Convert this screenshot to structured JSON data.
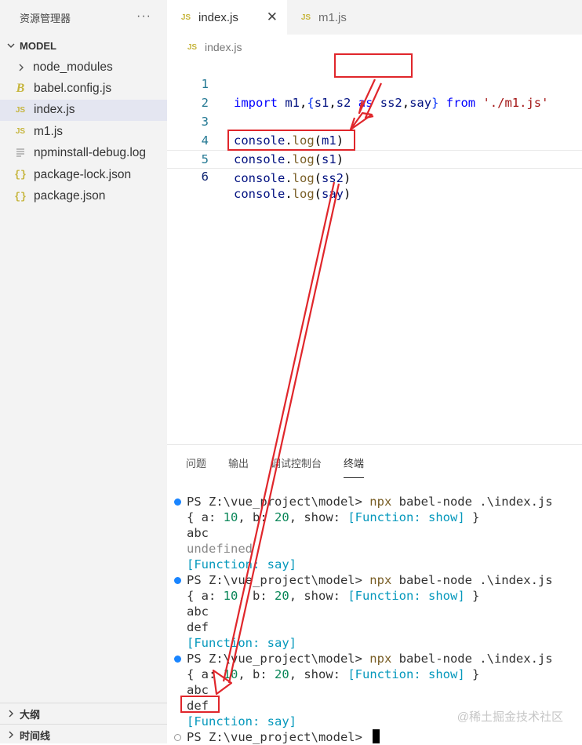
{
  "sidebar": {
    "title": "资源管理器",
    "more": "···",
    "section": "MODEL",
    "items": [
      {
        "label": "node_modules",
        "type": "folder"
      },
      {
        "label": "babel.config.js",
        "type": "babel"
      },
      {
        "label": "index.js",
        "type": "js",
        "active": true
      },
      {
        "label": "m1.js",
        "type": "js"
      },
      {
        "label": "npminstall-debug.log",
        "type": "log"
      },
      {
        "label": "package-lock.json",
        "type": "json"
      },
      {
        "label": "package.json",
        "type": "json"
      }
    ],
    "outline": "大纲",
    "timeline": "时间线"
  },
  "icons": {
    "js": "JS",
    "json": "{}",
    "babel": "B"
  },
  "editor": {
    "tabs": [
      {
        "label": "index.js",
        "active": true,
        "close": "✕"
      },
      {
        "label": "m1.js",
        "active": false
      }
    ],
    "breadcrumb": "index.js",
    "lines": [
      {
        "n": "1",
        "text": "import m1,{s1,s2 as ss2,say} from './m1.js'"
      },
      {
        "n": "2",
        "text": ""
      },
      {
        "n": "3",
        "text": "console.log(m1)"
      },
      {
        "n": "4",
        "text": "console.log(s1)"
      },
      {
        "n": "5",
        "text": "console.log(ss2)"
      },
      {
        "n": "6",
        "text": "console.log(say)"
      }
    ]
  },
  "panel": {
    "tabs": [
      "问题",
      "输出",
      "调试控制台",
      "终端"
    ],
    "active_tab": "终端",
    "terminal": [
      "PS Z:\\vue_project\\model> npx babel-node .\\index.js",
      "{ a: 10, b: 20, show: [Function: show] }",
      "abc",
      "undefined",
      "[Function: say]",
      "PS Z:\\vue_project\\model> npx babel-node .\\index.js",
      "{ a: 10, b: 20, show: [Function: show] }",
      "abc",
      "def",
      "[Function: say]",
      "PS Z:\\vue_project\\model> npx babel-node .\\index.js",
      "{ a: 10, b: 20, show: [Function: show] }",
      "abc",
      "def",
      "[Function: say]",
      "PS Z:\\vue_project\\model> "
    ]
  },
  "watermark": "@稀土掘金技术社区",
  "colors": {
    "annotation": "#e0262b",
    "sidebar_bg": "#f3f3f3",
    "active_item": "#e4e6f1",
    "terminal_dot": "#1a85ff"
  }
}
